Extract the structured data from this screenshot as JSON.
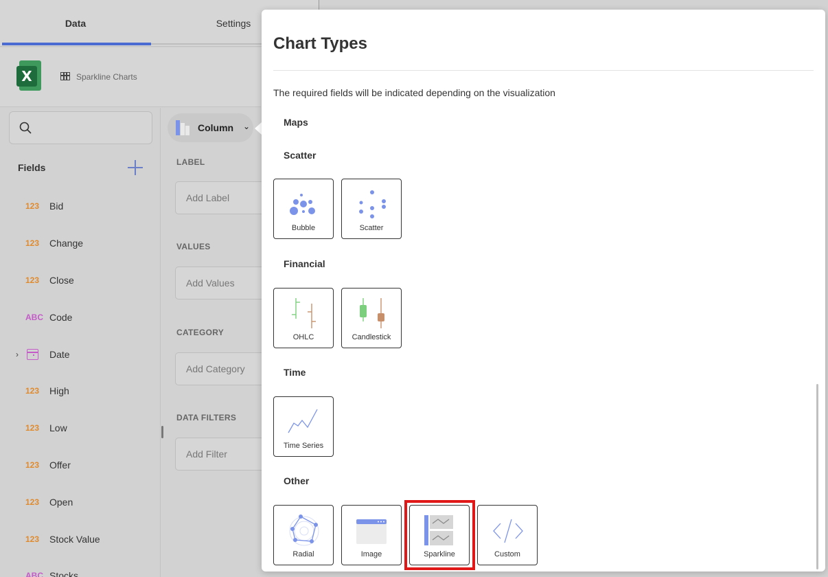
{
  "top_tabs": {
    "data": "Data",
    "settings": "Settings"
  },
  "source": {
    "name": "Sparkline Charts"
  },
  "fields_panel": {
    "search_placeholder": "",
    "title": "Fields",
    "items": [
      {
        "type": "123",
        "name": "Bid"
      },
      {
        "type": "123",
        "name": "Change"
      },
      {
        "type": "123",
        "name": "Close"
      },
      {
        "type": "ABC",
        "name": "Code"
      },
      {
        "type": "date",
        "name": "Date"
      },
      {
        "type": "123",
        "name": "High"
      },
      {
        "type": "123",
        "name": "Low"
      },
      {
        "type": "123",
        "name": "Offer"
      },
      {
        "type": "123",
        "name": "Open"
      },
      {
        "type": "123",
        "name": "Stock Value"
      },
      {
        "type": "ABC",
        "name": "Stocks"
      }
    ]
  },
  "props_panel": {
    "visualization": "Column",
    "label_head": "LABEL",
    "label_placeholder": "Add Label",
    "values_head": "VALUES",
    "values_placeholder": "Add Values",
    "category_head": "CATEGORY",
    "category_placeholder": "Add Category",
    "filters_head": "DATA FILTERS",
    "filters_placeholder": "Add Filter"
  },
  "chart_types": {
    "title": "Chart Types",
    "description": "The required fields will be indicated depending on the visualization",
    "sections": {
      "maps": "Maps",
      "scatter": "Scatter",
      "financial": "Financial",
      "time": "Time",
      "other": "Other"
    },
    "cards": {
      "bubble": "Bubble",
      "scatter": "Scatter",
      "ohlc": "OHLC",
      "candlestick": "Candlestick",
      "time_series": "Time Series",
      "radial": "Radial",
      "image": "Image",
      "sparkline": "Sparkline",
      "custom": "Custom"
    },
    "selected": "sparkline"
  },
  "colors": {
    "accent": "#4a6cd2",
    "icon_blue": "#7b93e8",
    "ohlc_green": "#7ccf7c",
    "ohlc_brown": "#c8906a",
    "highlight": "#e01818",
    "number_type": "#e08a2e",
    "text_type": "#c45bc8"
  }
}
